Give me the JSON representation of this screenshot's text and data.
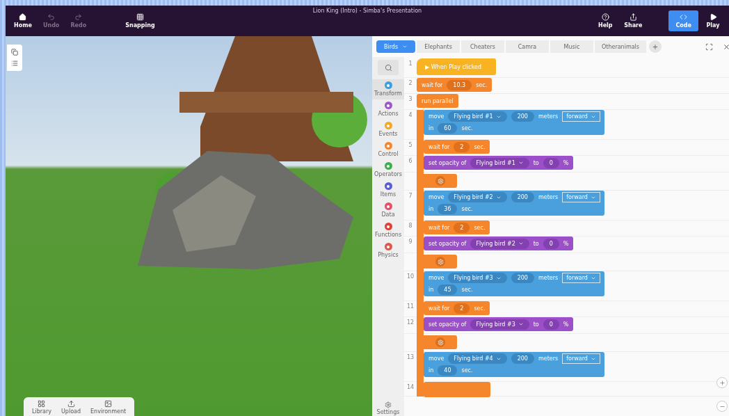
{
  "window": {
    "title": "Lion King (Intro) - Simba's Presentation"
  },
  "toolbar": {
    "left": [
      {
        "kind": "home",
        "label": "Home",
        "disabled": false
      },
      {
        "kind": "undo",
        "label": "Undo",
        "disabled": true
      },
      {
        "kind": "redo",
        "label": "Redo",
        "disabled": true
      },
      {
        "kind": "snapping",
        "label": "Snapping",
        "disabled": false
      }
    ],
    "right": [
      {
        "kind": "help",
        "label": "Help",
        "selected": false
      },
      {
        "kind": "share",
        "label": "Share",
        "selected": false
      },
      {
        "kind": "code",
        "label": "Code",
        "selected": true
      },
      {
        "kind": "play",
        "label": "Play",
        "selected": false
      }
    ]
  },
  "viewport": {
    "bottom_panel": [
      {
        "kind": "library",
        "label": "Library"
      },
      {
        "kind": "upload",
        "label": "Upload"
      },
      {
        "kind": "environment",
        "label": "Environment"
      }
    ]
  },
  "code_panel": {
    "tabs": [
      {
        "label": "Birds",
        "selected": true
      },
      {
        "label": "Elephants",
        "selected": false
      },
      {
        "label": "Cheaters",
        "selected": false
      },
      {
        "label": "Camra",
        "selected": false
      },
      {
        "label": "Music",
        "selected": false
      },
      {
        "label": "Otheranimals",
        "selected": false
      }
    ],
    "add_tab": "+",
    "categories": [
      {
        "label": "Transform",
        "color": "#3aa0e0",
        "selected": true
      },
      {
        "label": "Actions",
        "color": "#9b59c9",
        "selected": false
      },
      {
        "label": "Events",
        "color": "#f5a623",
        "selected": false
      },
      {
        "label": "Control",
        "color": "#f5862c",
        "selected": false
      },
      {
        "label": "Operators",
        "color": "#3cb04a",
        "selected": false
      },
      {
        "label": "Items",
        "color": "#5a5fd0",
        "selected": false
      },
      {
        "label": "Data",
        "color": "#e8506a",
        "selected": false
      },
      {
        "label": "Functions",
        "color": "#e0403a",
        "selected": false
      },
      {
        "label": "Physics",
        "color": "#e2574c",
        "selected": false
      }
    ],
    "settings": "Settings",
    "script": [
      {
        "kind": "hat",
        "line": "1",
        "label": "▶ When Play clicked"
      },
      {
        "kind": "wait",
        "line": "2",
        "text": "wait for",
        "value": "10.3",
        "unit": "sec."
      },
      {
        "kind": "parallel",
        "line": "3",
        "label": "run parallel",
        "children": [
          {
            "kind": "move",
            "line": "4",
            "verb": "move",
            "object": "Flying bird #1",
            "distance": "200",
            "unit": "meters",
            "direction": "forward",
            "in": "in",
            "duration": "60",
            "sec": "sec."
          },
          {
            "kind": "wait",
            "line": "5",
            "text": "wait for",
            "value": "2",
            "unit": "sec."
          },
          {
            "kind": "opacity",
            "line": "6",
            "text": "set opacity of",
            "object": "Flying bird #1",
            "to": "to",
            "value": "0",
            "unit": "%"
          },
          {
            "kind": "gear"
          },
          {
            "kind": "move",
            "line": "7",
            "verb": "move",
            "object": "Flying bird #2",
            "distance": "200",
            "unit": "meters",
            "direction": "forward",
            "in": "in",
            "duration": "36",
            "sec": "sec."
          },
          {
            "kind": "wait",
            "line": "8",
            "text": "wait for",
            "value": "2",
            "unit": "sec."
          },
          {
            "kind": "opacity",
            "line": "9",
            "text": "set opacity of",
            "object": "Flying bird #2",
            "to": "to",
            "value": "0",
            "unit": "%"
          },
          {
            "kind": "gear"
          },
          {
            "kind": "move",
            "line": "10",
            "verb": "move",
            "object": "Flying bird #3",
            "distance": "200",
            "unit": "meters",
            "direction": "forward",
            "in": "in",
            "duration": "45",
            "sec": "sec."
          },
          {
            "kind": "wait",
            "line": "11",
            "text": "wait for",
            "value": "2",
            "unit": "sec."
          },
          {
            "kind": "opacity",
            "line": "12",
            "text": "set opacity of",
            "object": "Flying bird #3",
            "to": "to",
            "value": "0",
            "unit": "%"
          },
          {
            "kind": "gear"
          },
          {
            "kind": "move",
            "line": "13",
            "verb": "move",
            "object": "Flying bird #4",
            "distance": "200",
            "unit": "meters",
            "direction": "forward",
            "in": "in",
            "duration": "40",
            "sec": "sec."
          },
          {
            "kind": "stub",
            "line": "14"
          }
        ]
      }
    ]
  }
}
